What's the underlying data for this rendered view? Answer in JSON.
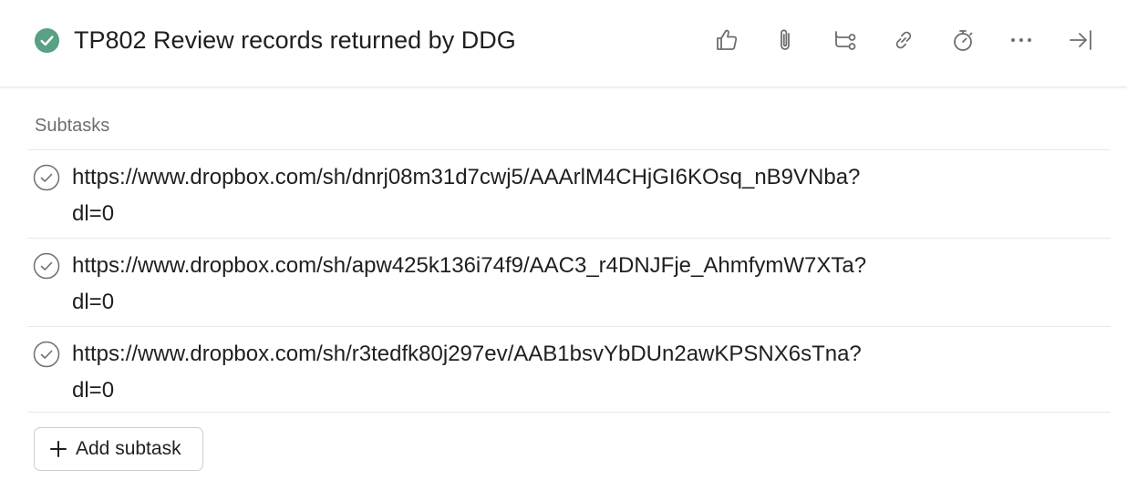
{
  "task": {
    "title": "TP802 Review records returned by DDG",
    "completed": true,
    "complete_color": "#58a182"
  },
  "toolbar": {
    "items": [
      {
        "icon": "thumbs-up-icon"
      },
      {
        "icon": "paperclip-icon"
      },
      {
        "icon": "subtask-branch-icon"
      },
      {
        "icon": "link-icon"
      },
      {
        "icon": "stopwatch-icon"
      },
      {
        "icon": "more-icon"
      },
      {
        "icon": "close-pane-icon"
      }
    ]
  },
  "subtasks": {
    "label": "Subtasks",
    "items": [
      {
        "line1": "https://www.dropbox.com/sh/dnrj08m31d7cwj5/AAArlM4CHjGI6KOsq_nB9VNba?",
        "line2": "dl=0"
      },
      {
        "line1": "https://www.dropbox.com/sh/apw425k136i74f9/AAC3_r4DNJFje_AhmfymW7XTa?",
        "line2": "dl=0"
      },
      {
        "line1": "https://www.dropbox.com/sh/r3tedfk80j297ev/AAB1bsvYbDUn2awKPSNX6sTna?",
        "line2": "dl=0"
      }
    ],
    "add_label": "Add subtask"
  }
}
